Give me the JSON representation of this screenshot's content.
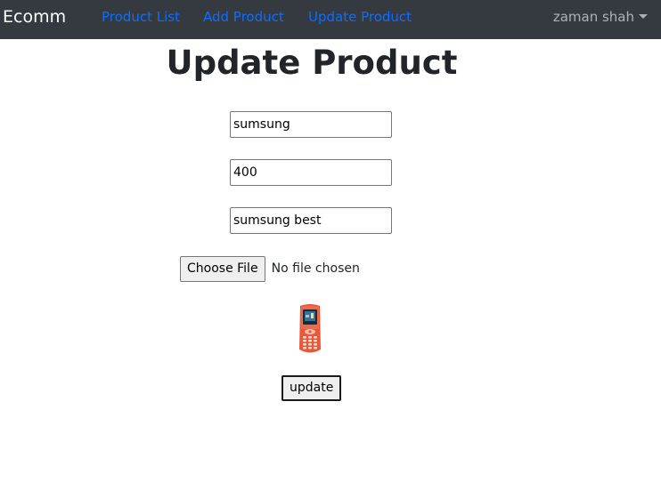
{
  "navbar": {
    "brand": "Ecomm",
    "links": [
      {
        "label": "Product List",
        "color": "#0d6efd"
      },
      {
        "label": "Add Product",
        "color": "#0d6efd"
      },
      {
        "label": "Update Product",
        "color": "#0d6efd"
      }
    ],
    "user": "zaman shah",
    "background": "#343a40"
  },
  "main": {
    "title": "Update Product",
    "fields": {
      "name": "sumsung",
      "price": "400",
      "description": "sumsung best"
    },
    "file_input": {
      "button_label": "Choose File",
      "status": "No file chosen"
    },
    "image": {
      "icon": "mobile-phone"
    },
    "submit_label": "update"
  }
}
